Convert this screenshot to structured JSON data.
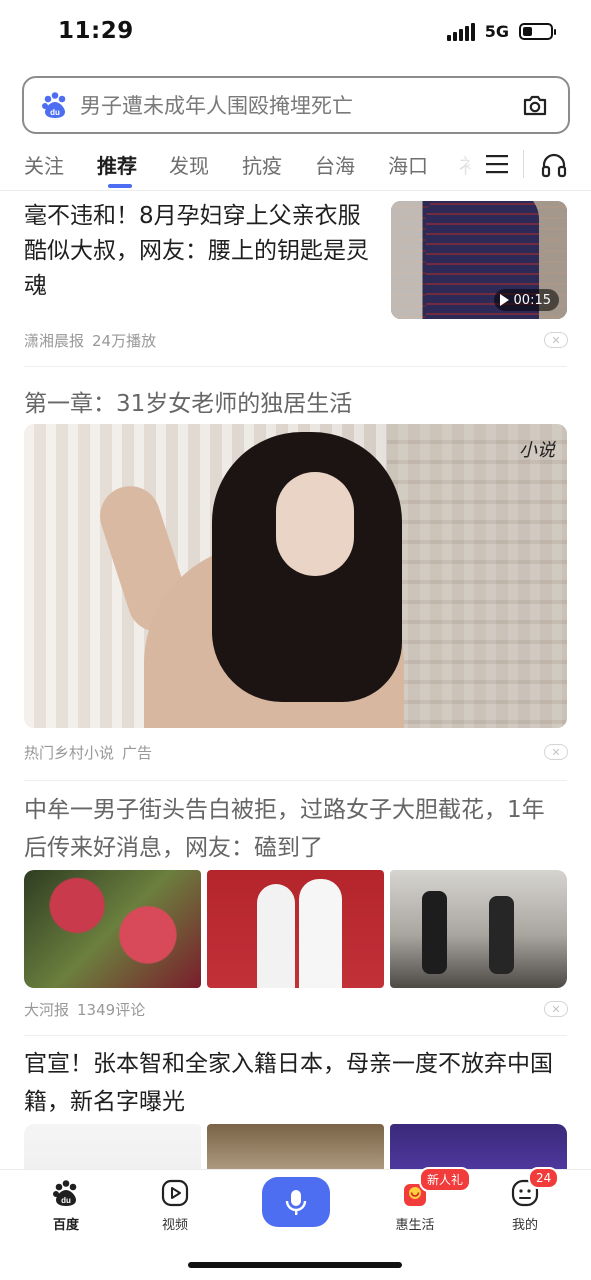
{
  "status_bar": {
    "time": "11:29",
    "network": "5G"
  },
  "search": {
    "placeholder": "男子遭未成年人围殴掩埋死亡"
  },
  "tabs": [
    {
      "label": "关注"
    },
    {
      "label": "推荐",
      "active": true
    },
    {
      "label": "发现"
    },
    {
      "label": "抗疫"
    },
    {
      "label": "台海"
    },
    {
      "label": "海口"
    },
    {
      "label": "衤"
    }
  ],
  "feed": {
    "item1": {
      "title": "毫不违和！8月孕妇穿上父亲衣服酷似大叔，网友：腰上的钥匙是灵魂",
      "source": "潇湘晨报",
      "stat": "24万播放",
      "duration": "00:15"
    },
    "ad": {
      "title": "第一章：31岁女老师的独居生活",
      "watermark": "小说",
      "source": "热门乡村小说",
      "tag": "广告"
    },
    "item3": {
      "title": "中牟一男子街头告白被拒，过路女子大胆截花，1年后传来好消息，网友：磕到了",
      "source": "大河报",
      "stat": "1349评论"
    },
    "item4": {
      "title": "官宣！张本智和全家入籍日本，母亲一度不放弃中国籍，新名字曝光"
    }
  },
  "bottom_nav": {
    "baidu": "百度",
    "video": "视频",
    "life": "惠生活",
    "life_badge": "新人礼",
    "mine": "我的",
    "mine_badge": "24"
  },
  "colors": {
    "accent": "#4e6ef2",
    "badge": "#f23b3b"
  }
}
